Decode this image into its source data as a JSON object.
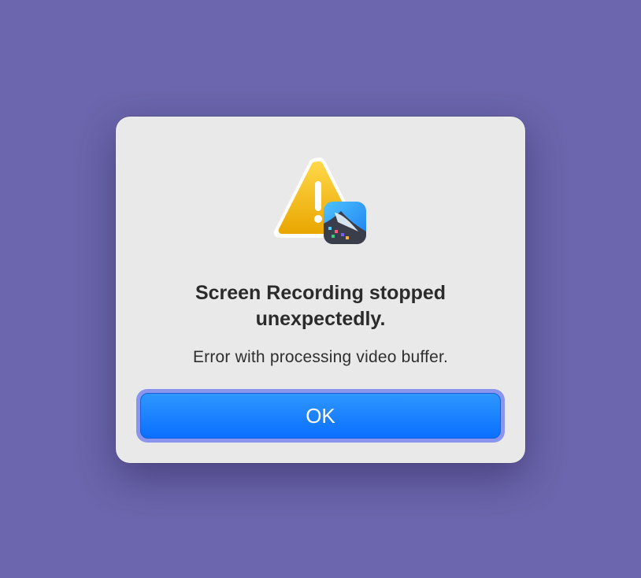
{
  "dialog": {
    "title": "Screen Recording stopped\nunexpectedly.",
    "message": "Error with processing video buffer.",
    "ok_label": "OK",
    "icons": {
      "warning": "warning-triangle-icon",
      "app": "screen-recording-app-icon"
    }
  },
  "colors": {
    "background": "#6b66ad",
    "dialog_bg": "#e9e9e9",
    "button_blue": "#0a6fff",
    "warning_yellow": "#f0b400"
  }
}
